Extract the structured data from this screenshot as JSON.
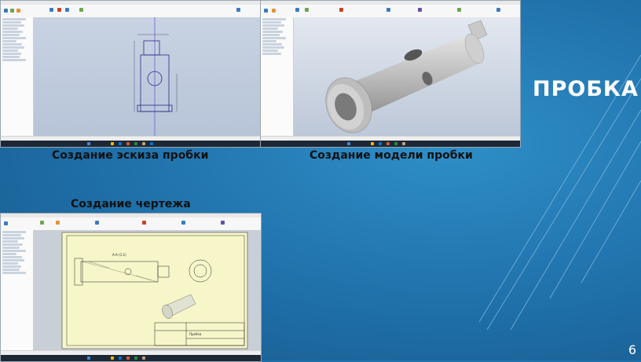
{
  "slide": {
    "title": "ПРОБКА",
    "page_number": "6"
  },
  "captions": {
    "sketch": "Создание эскиза пробки",
    "model": "Создание модели пробки",
    "drawing": "Создание чертежа"
  },
  "colors": {
    "background": "#1f6fa8",
    "title_text": "#ffffff",
    "caption_text": "#111111"
  },
  "screenshots": [
    {
      "id": "sketch",
      "app": "Autodesk Inventor",
      "view": "2D sketch"
    },
    {
      "id": "model",
      "app": "Autodesk Inventor",
      "view": "3D part model"
    },
    {
      "id": "drawing",
      "app": "Autodesk Inventor",
      "view": "drawing sheet"
    }
  ],
  "drawing_sheet": {
    "title_block_name": "Пробка",
    "section_label": "А-А (1:1)"
  }
}
